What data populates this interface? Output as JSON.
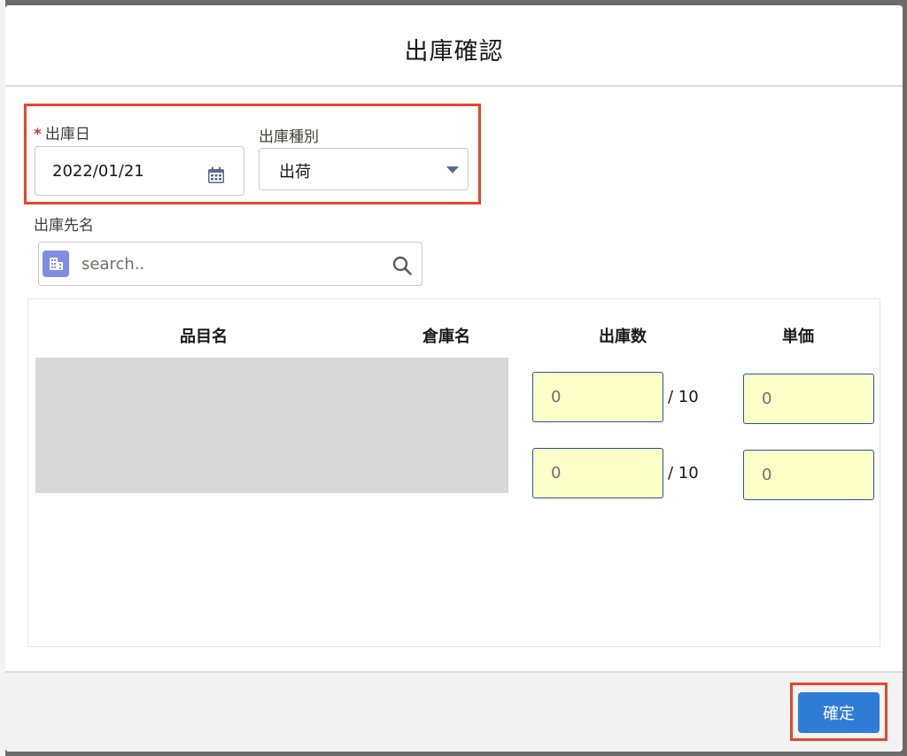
{
  "dialog": {
    "title": "出庫確認"
  },
  "form": {
    "shipping_date": {
      "label": "出庫日",
      "required_mark": "*",
      "value": "2022/01/21"
    },
    "shipping_type": {
      "label": "出庫種別",
      "value": "出荷"
    },
    "destination": {
      "label": "出庫先名",
      "placeholder": "search.."
    }
  },
  "table": {
    "headers": [
      "品目名",
      "倉庫名",
      "出庫数",
      "単価"
    ],
    "rows": [
      {
        "quantity": "0",
        "quantity_max": "/ 10",
        "unit_price": "0"
      },
      {
        "quantity": "0",
        "quantity_max": "/ 10",
        "unit_price": "0"
      }
    ]
  },
  "footer": {
    "confirm_label": "確定"
  },
  "colors": {
    "accent": "#2e7cd6",
    "highlight": "#e8462f",
    "input_bg": "#fdffc9",
    "input_border": "#2a5592"
  }
}
